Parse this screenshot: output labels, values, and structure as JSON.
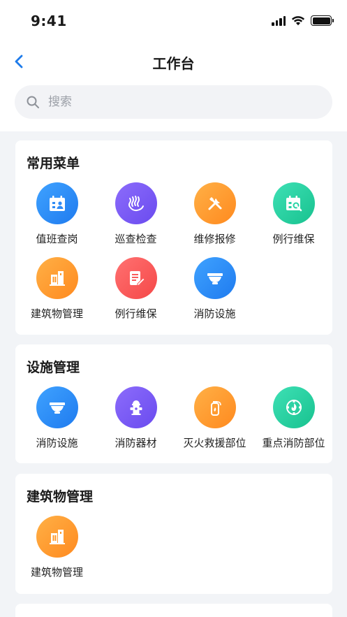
{
  "status": {
    "time": "9:41"
  },
  "nav": {
    "title": "工作台"
  },
  "search": {
    "placeholder": "搜索"
  },
  "colors": {
    "blue": "#2F8BF5",
    "purple": "#7B5CF5",
    "orange": "#FF9A2B",
    "green": "#26D3A4",
    "red": "#F95B5B"
  },
  "sections": [
    {
      "title": "常用菜单",
      "items": [
        {
          "label": "值班查岗",
          "icon": "calendar-person-icon"
        },
        {
          "label": "巡查检查",
          "icon": "patrol-icon"
        },
        {
          "label": "维修报修",
          "icon": "wrench-hammer-icon"
        },
        {
          "label": "例行维保",
          "icon": "calendar-search-icon"
        },
        {
          "label": "建筑物管理",
          "icon": "building-icon"
        },
        {
          "label": "例行维保",
          "icon": "document-edit-icon"
        },
        {
          "label": "消防设施",
          "icon": "smoke-detector-icon"
        }
      ]
    },
    {
      "title": "设施管理",
      "items": [
        {
          "label": "消防设施",
          "icon": "smoke-detector-icon"
        },
        {
          "label": "消防器材",
          "icon": "fire-hydrant-icon"
        },
        {
          "label": "灭火救援部位",
          "icon": "fire-extinguisher-icon"
        },
        {
          "label": "重点消防部位",
          "icon": "fire-badge-icon"
        }
      ]
    },
    {
      "title": "建筑物管理",
      "items": [
        {
          "label": "建筑物管理",
          "icon": "building-icon"
        }
      ]
    }
  ]
}
